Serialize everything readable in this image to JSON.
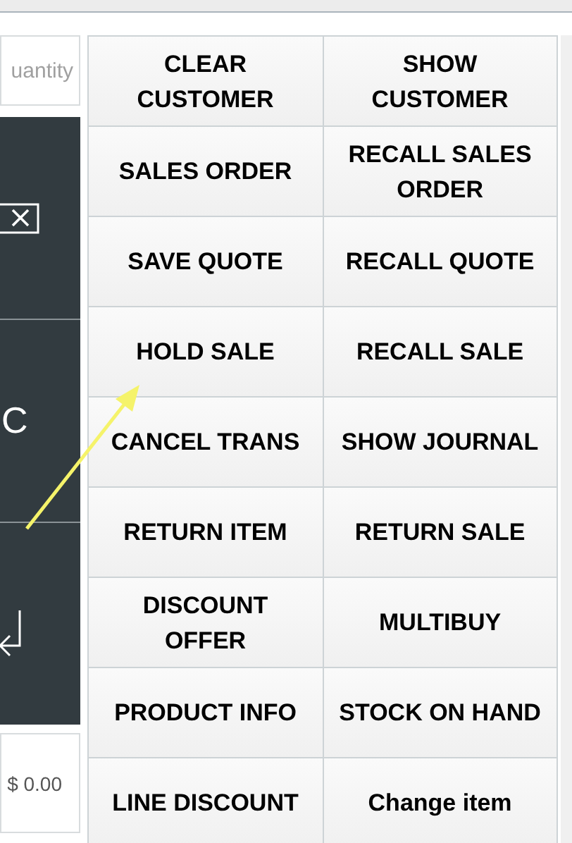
{
  "quantity_field": {
    "placeholder": "uantity"
  },
  "keypad": [
    {
      "kind": "clear"
    },
    {
      "kind": "text",
      "label": "C"
    },
    {
      "kind": "enter"
    }
  ],
  "total": "$ 0.00",
  "buttons": [
    "CLEAR\nCUSTOMER",
    "SALES ORDER",
    "SAVE QUOTE",
    "HOLD SALE",
    "CANCEL TRANS",
    "RETURN ITEM",
    "DISCOUNT\nOFFER",
    "PRODUCT INFO",
    "LINE DISCOUNT",
    "SHOW\nCUSTOMER",
    "RECALL SALES\nORDER",
    "RECALL QUOTE",
    "RECALL SALE",
    "SHOW JOURNAL",
    "RETURN SALE",
    "MULTIBUY",
    "STOCK ON HAND",
    "Change item"
  ]
}
